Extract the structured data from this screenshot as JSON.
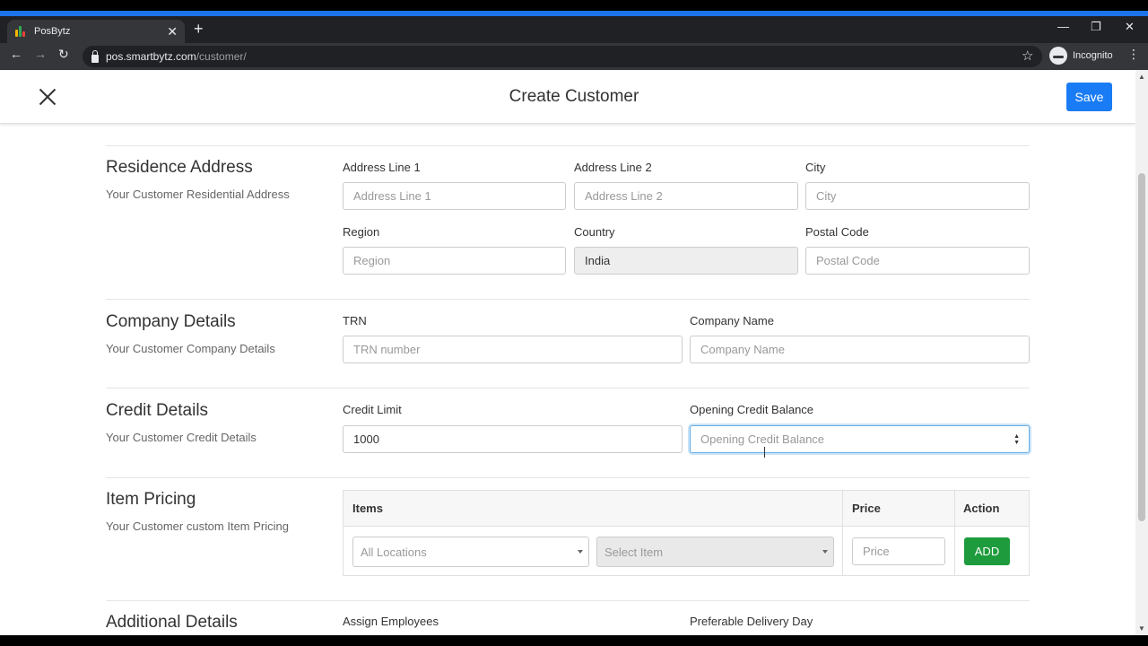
{
  "browser": {
    "tab_title": "PosBytz",
    "url_host": "pos.smartbytz.com",
    "url_path": "/customer/",
    "profile_label": "Incognito"
  },
  "header": {
    "title": "Create Customer",
    "save_label": "Save"
  },
  "residence": {
    "title": "Residence Address",
    "subtitle": "Your Customer Residential Address",
    "address1_label": "Address Line 1",
    "address1_placeholder": "Address Line 1",
    "address2_label": "Address Line 2",
    "address2_placeholder": "Address Line 2",
    "city_label": "City",
    "city_placeholder": "City",
    "region_label": "Region",
    "region_placeholder": "Region",
    "country_label": "Country",
    "country_value": "India",
    "postal_label": "Postal Code",
    "postal_placeholder": "Postal Code"
  },
  "company": {
    "title": "Company Details",
    "subtitle": "Your Customer Company Details",
    "trn_label": "TRN",
    "trn_placeholder": "TRN number",
    "name_label": "Company Name",
    "name_placeholder": "Company Name"
  },
  "credit": {
    "title": "Credit Details",
    "subtitle": "Your Customer Credit Details",
    "limit_label": "Credit Limit",
    "limit_value": "1000",
    "opening_label": "Opening Credit Balance",
    "opening_placeholder": "Opening Credit Balance"
  },
  "pricing": {
    "title": "Item Pricing",
    "subtitle": "Your Customer custom Item Pricing",
    "col_items": "Items",
    "col_price": "Price",
    "col_action": "Action",
    "locations_value": "All Locations",
    "item_placeholder": "Select Item",
    "price_placeholder": "Price",
    "add_label": "ADD"
  },
  "additional": {
    "title": "Additional Details",
    "employees_label": "Assign Employees",
    "delivery_label": "Preferable Delivery Day"
  },
  "colors": {
    "primary": "#1a7cf4",
    "success": "#1e9b3c",
    "chrome_accent": "#1a73e8"
  }
}
